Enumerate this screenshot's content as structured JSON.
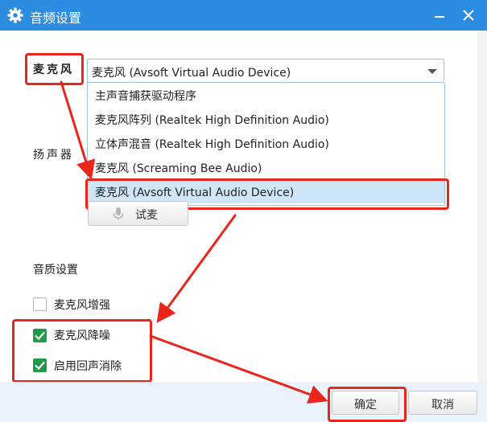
{
  "window": {
    "title": "音频设置",
    "icon": "gear-icon"
  },
  "microphone": {
    "label": "麦克风",
    "selected": "麦克风 (Avsoft Virtual Audio Device)",
    "options": [
      "主声音捕获驱动程序",
      "麦克风阵列 (Realtek High Definition Audio)",
      "立体声混音 (Realtek High Definition Audio)",
      "麦克风 (Screaming Bee Audio)",
      "麦克风 (Avsoft Virtual Audio Device)"
    ],
    "highlighted_index": 4
  },
  "speaker": {
    "label": "扬声器"
  },
  "test_button": "试麦",
  "quality": {
    "title": "音质设置",
    "checkboxes": [
      {
        "label": "麦克风增强",
        "checked": false
      },
      {
        "label": "麦克风降噪",
        "checked": true
      },
      {
        "label": "启用回声消除",
        "checked": true
      }
    ]
  },
  "footer": {
    "ok": "确定",
    "cancel": "取消"
  },
  "colors": {
    "titlebar": "#2b8ce0",
    "highlight": "#e8261c",
    "check": "#1e9b46",
    "selected_option": "#cfe6f8"
  }
}
